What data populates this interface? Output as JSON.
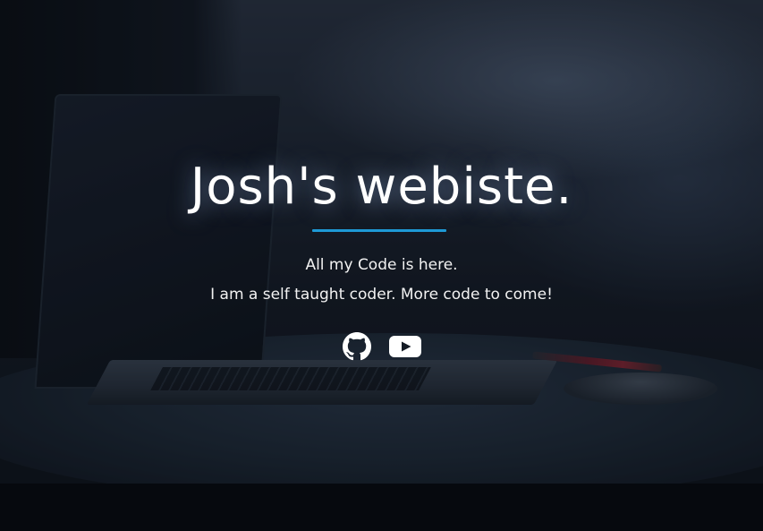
{
  "hero": {
    "title": "Josh's webiste.",
    "subtitle_line1": "All my Code is here.",
    "subtitle_line2": "I am a self taught coder. More code to come!",
    "accent_color": "#1e9ad6"
  },
  "social": {
    "links": [
      {
        "icon": "github-icon"
      },
      {
        "icon": "youtube-icon"
      }
    ]
  }
}
